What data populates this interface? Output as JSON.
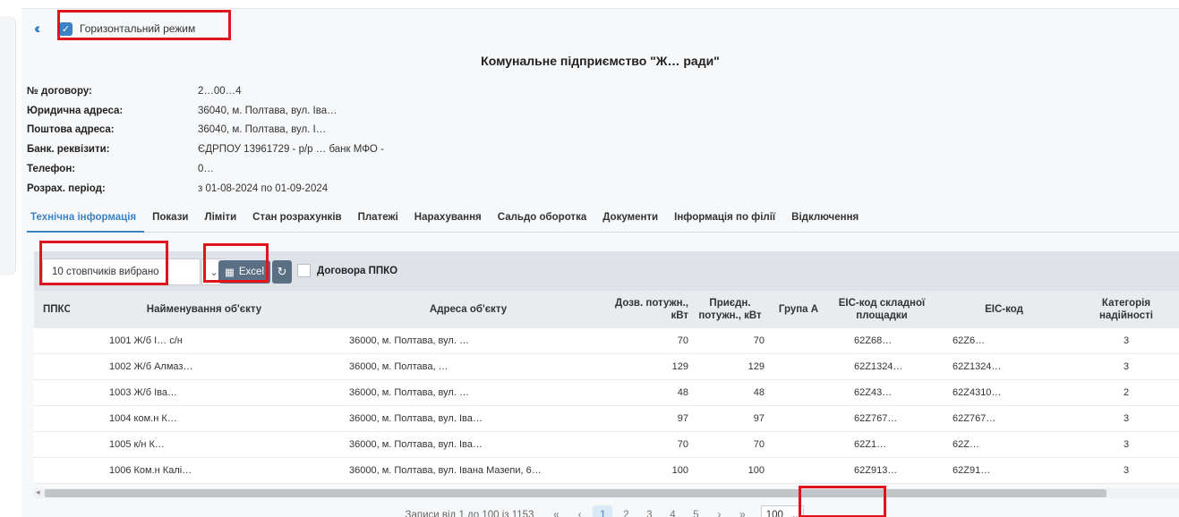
{
  "topbar": {
    "horizontal_mode_label": "Горизонтальний режим",
    "horizontal_mode_checked": true
  },
  "org_title": "Комунальне підприємство \"Ж… ради\"",
  "info": [
    {
      "label": "№ договору:",
      "value": "2…00…4"
    },
    {
      "label": "Юридична адреса:",
      "value": "36040, м. Полтава, вул. Іва…"
    },
    {
      "label": "Поштова адреса:",
      "value": "36040, м. Полтава, вул. І…"
    },
    {
      "label": "Банк. реквізити:",
      "value": "ЄДРПОУ 13961729 - р/р … банк МФО -"
    },
    {
      "label": "Телефон:",
      "value": "0…"
    },
    {
      "label": "Розрах. період:",
      "value": "з 01-08-2024 по 01-09-2024"
    }
  ],
  "tabs": [
    "Технічна інформація",
    "Покази",
    "Ліміти",
    "Стан розрахунків",
    "Платежі",
    "Нарахування",
    "Сальдо оборотка",
    "Документи",
    "Інформація по філії",
    "Відключення"
  ],
  "toolbar": {
    "columns_selected": "10 стовпчиків вибрано",
    "excel_label": "Excel",
    "ppko_label": "Договора ППКО"
  },
  "table": {
    "headers": {
      "ppko": "ППКО",
      "name": "Найменування об'єкту",
      "address": "Адреса об'єкту",
      "allowed_power": "Дозв. потужн., кВт",
      "connected_power": "Приєдн. потужн., кВт",
      "group_a": "Група А",
      "eic_site": "ЕІС-код складної площадки",
      "eic": "ЕІС-код",
      "reliability": "Категорія надійності"
    },
    "rows": [
      {
        "name": "1001 Ж/б І… с/н",
        "address": "36000, м. Полтава, вул. …",
        "allowed_power": "70",
        "connected_power": "70",
        "eic_site": "62Z68…",
        "eic": "62Z6…",
        "reliability": "3"
      },
      {
        "name": "1002 Ж/б Алмаз…",
        "address": "36000, м. Полтава, …",
        "allowed_power": "129",
        "connected_power": "129",
        "eic_site": "62Z1324…",
        "eic": "62Z1324…",
        "reliability": "3"
      },
      {
        "name": "1003 Ж/б Іва…",
        "address": "36000, м. Полтава, вул. …",
        "allowed_power": "48",
        "connected_power": "48",
        "eic_site": "62Z43…",
        "eic": "62Z4310…",
        "reliability": "2"
      },
      {
        "name": "1004 ком.н К…",
        "address": "36000, м. Полтава, вул. Іва…",
        "allowed_power": "97",
        "connected_power": "97",
        "eic_site": "62Z767…",
        "eic": "62Z767…",
        "reliability": "3"
      },
      {
        "name": "1005 к/н К…",
        "address": "36000, м. Полтава, вул. Іва…",
        "allowed_power": "70",
        "connected_power": "70",
        "eic_site": "62Z1…",
        "eic": "62Z…",
        "reliability": "3"
      },
      {
        "name": "1006 Ком.н Калі…",
        "address": "36000, м. Полтава, вул. Івана Мазепи, 6…",
        "allowed_power": "100",
        "connected_power": "100",
        "eic_site": "62Z913…",
        "eic": "62Z91…",
        "reliability": "3"
      }
    ]
  },
  "pager": {
    "info": "Записи від 1 до 100 із 1153",
    "first": "«",
    "prev": "‹",
    "pages": [
      "1",
      "2",
      "3",
      "4",
      "5"
    ],
    "next": "›",
    "last": "»",
    "page_size": "100"
  },
  "icons": {
    "collapse": "double-chevron-left-icon",
    "excel": "excel-file-icon",
    "refresh": "refresh-icon",
    "caret": "chevron-down-icon"
  },
  "colors": {
    "accent": "#3b82c4",
    "button": "#5a6f83",
    "highlight_box": "#e0141d"
  }
}
